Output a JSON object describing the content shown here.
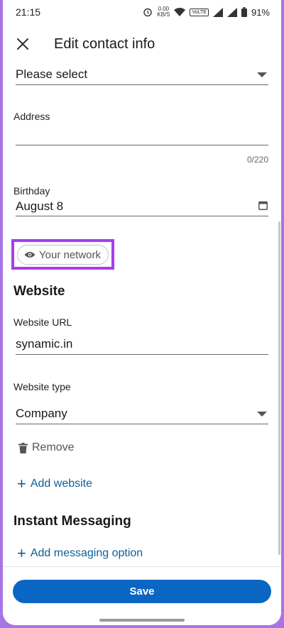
{
  "status_bar": {
    "time": "21:15",
    "speed": "0.00",
    "speed_unit": "KB/S",
    "volte": "VoLTE",
    "battery": "91%"
  },
  "header": {
    "title": "Edit contact info",
    "close_icon": "close-icon"
  },
  "form": {
    "phone_type_select": "Please select",
    "address_label": "Address",
    "address_value": "",
    "address_counter": "0/220",
    "birthday_label": "Birthday",
    "birthday_value": "August 8",
    "visibility_label": "Your network",
    "website_section_title": "Website",
    "website_url_label": "Website URL",
    "website_url_value": "synamic.in",
    "website_type_label": "Website type",
    "website_type_value": "Company",
    "remove_label": "Remove",
    "add_website_label": "Add website",
    "im_section_title": "Instant Messaging",
    "add_messaging_label": "Add messaging option"
  },
  "footer": {
    "save_label": "Save"
  },
  "colors": {
    "accent": "#0a66c2",
    "link": "#0a5f9a",
    "highlight_border": "#a53df0",
    "background_frame": "#a774e6"
  }
}
